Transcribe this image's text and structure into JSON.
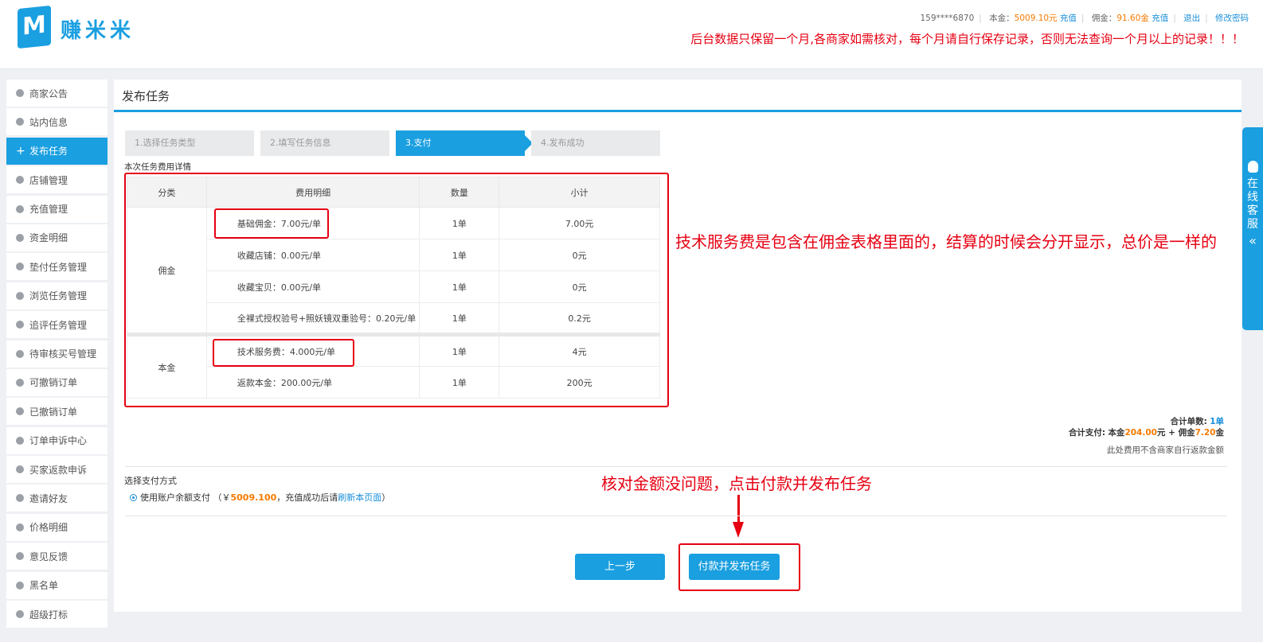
{
  "header": {
    "logo_letter": "M",
    "brand": "赚米米",
    "phone": "159****6870",
    "principal_label": "本金：",
    "principal_value": "5009.10元",
    "recharge1": "充值",
    "commission_label": "佣金：",
    "commission_value": "91.60金",
    "recharge2": "充值",
    "logout": "退出",
    "change_password": "修改密码",
    "notice": "后台数据只保留一个月,各商家如需核对，每个月请自行保存记录，否则无法查询一个月以上的记录！！！"
  },
  "sidebar": {
    "items": [
      {
        "label": "商家公告"
      },
      {
        "label": "站内信息"
      },
      {
        "label": "发布任务",
        "active": true
      },
      {
        "label": "店铺管理"
      },
      {
        "label": "充值管理"
      },
      {
        "label": "资金明细"
      },
      {
        "label": "垫付任务管理"
      },
      {
        "label": "浏览任务管理"
      },
      {
        "label": "追评任务管理"
      },
      {
        "label": "待审核买号管理"
      },
      {
        "label": "可撤销订单"
      },
      {
        "label": "已撤销订单"
      },
      {
        "label": "订单申诉中心"
      },
      {
        "label": "买家返款申诉"
      },
      {
        "label": "邀请好友"
      },
      {
        "label": "价格明细"
      },
      {
        "label": "意见反馈"
      },
      {
        "label": "黑名单"
      },
      {
        "label": "超级打标"
      }
    ]
  },
  "main": {
    "title": "发布任务",
    "steps": [
      "1.选择任务类型",
      "2.填写任务信息",
      "3.支付",
      "4.发布成功"
    ],
    "detail_label": "本次任务费用详情"
  },
  "table": {
    "headers": [
      "分类",
      "费用明细",
      "数量",
      "小计"
    ],
    "group_commission": "佣金",
    "group_principal": "本金",
    "rows": [
      {
        "desc": "基础佣金：7.00元/单",
        "qty": "1单",
        "subtotal": "7.00元"
      },
      {
        "desc": "收藏店铺：0.00元/单",
        "qty": "1单",
        "subtotal": "0元"
      },
      {
        "desc": "收藏宝贝：0.00元/单",
        "qty": "1单",
        "subtotal": "0元"
      },
      {
        "desc": "全裸式授权验号+照妖镜双重验号：0.20元/单",
        "qty": "1单",
        "subtotal": "0.2元"
      },
      {
        "desc": "技术服务费：4.000元/单",
        "qty": "1单",
        "subtotal": "4元"
      },
      {
        "desc": "返款本金：200.00元/单",
        "qty": "1单",
        "subtotal": "200元"
      }
    ]
  },
  "annotations": {
    "fee_note": "技术服务费是包含在佣金表格里面的，结算的时候会分开显示，总价是一样的",
    "pay_note": "核对金额没问题，点击付款并发布任务"
  },
  "summary": {
    "count_label": "合计单数:",
    "count_value": "1单",
    "pay_label": "合计支付:",
    "principal_text": "本金",
    "principal_amount": "204.00",
    "yuan_plus": "元 + 佣金",
    "commission_amount": "7.20",
    "jin": "金",
    "note": "此处费用不含商家自行返款金额"
  },
  "payment": {
    "label": "选择支付方式",
    "option_text": "使用账户余额支付 （￥",
    "balance": "5009.100",
    "option_suffix": "，充值成功后请",
    "refresh_link": "刷新本页面",
    "close_paren": "）"
  },
  "buttons": {
    "prev": "上一步",
    "pay": "付款并发布任务"
  },
  "service": {
    "label": "在线客服",
    "chevron": "«"
  },
  "colors": {
    "accent": "#1a9fe0",
    "warning_red": "#e60012",
    "amount_orange": "#f57a00"
  }
}
